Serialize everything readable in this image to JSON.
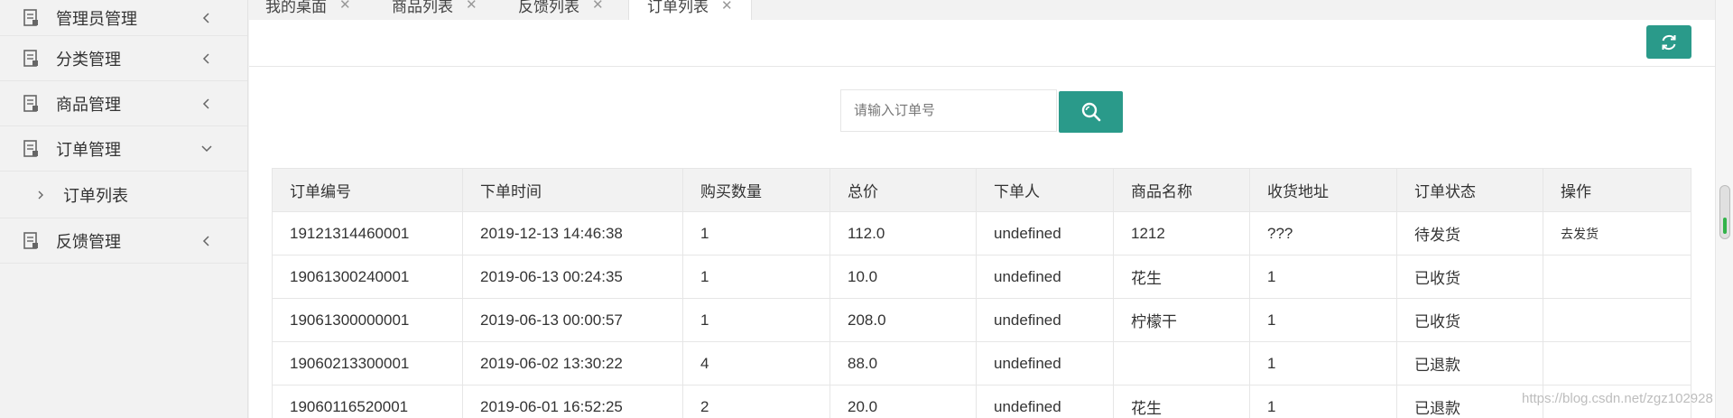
{
  "sidebar": {
    "items": [
      {
        "label": "管理员管理",
        "arrow": "chevron-left-icon"
      },
      {
        "label": "分类管理",
        "arrow": "chevron-left-icon"
      },
      {
        "label": "商品管理",
        "arrow": "chevron-left-icon"
      },
      {
        "label": "订单管理",
        "arrow": "chevron-down-icon"
      },
      {
        "label": "订单列表"
      },
      {
        "label": "反馈管理",
        "arrow": "chevron-left-icon"
      }
    ]
  },
  "tabs": [
    {
      "label": "我的桌面"
    },
    {
      "label": "商品列表"
    },
    {
      "label": "反馈列表"
    },
    {
      "label": "订单列表",
      "active": true
    }
  ],
  "search": {
    "placeholder": "请输入订单号",
    "value": ""
  },
  "table": {
    "headers": [
      "订单编号",
      "下单时间",
      "购买数量",
      "总价",
      "下单人",
      "商品名称",
      "收货地址",
      "订单状态",
      "操作"
    ],
    "rows": [
      [
        "19121314460001",
        "2019-12-13 14:46:38",
        "1",
        "112.0",
        "undefined",
        "1212",
        "???",
        "待发货",
        "去发货"
      ],
      [
        "19061300240001",
        "2019-06-13 00:24:35",
        "1",
        "10.0",
        "undefined",
        "花生",
        "1",
        "已收货",
        ""
      ],
      [
        "19061300000001",
        "2019-06-13 00:00:57",
        "1",
        "208.0",
        "undefined",
        "柠檬干",
        "1",
        "已收货",
        ""
      ],
      [
        "19060213300001",
        "2019-06-02 13:30:22",
        "4",
        "88.0",
        "undefined",
        "",
        "1",
        "已退款",
        ""
      ],
      [
        "19060116520001",
        "2019-06-01 16:52:25",
        "2",
        "20.0",
        "undefined",
        "花生",
        "1",
        "已退款",
        ""
      ]
    ]
  },
  "watermark": "https://blog.csdn.net/zgz102928",
  "colors": {
    "accent": "#2a9a8a",
    "sidebar_bg": "#f2f2f2",
    "header_bg": "#f2f2f2"
  }
}
